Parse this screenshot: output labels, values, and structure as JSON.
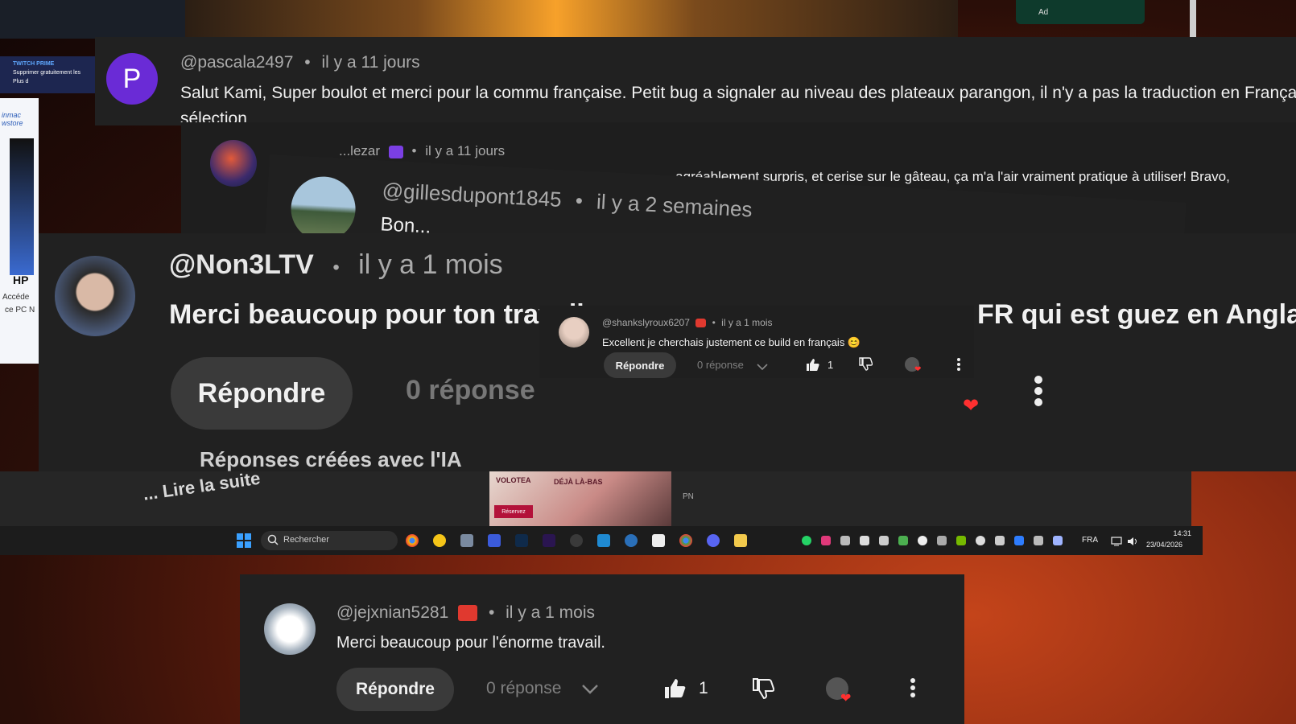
{
  "top_banner": {
    "ad_label": "Ad"
  },
  "twitch_prime": {
    "title": "TWITCH PRIME",
    "line1": "Supprimer gratuitement les",
    "line2": "Plus d"
  },
  "side_promo": {
    "brand": "inmac wstore",
    "model": "HP",
    "line1": "Accéde",
    "line2": "ce PC N"
  },
  "comment_pascala": {
    "avatar_letter": "P",
    "handle": "@pascala2497",
    "sep": "•",
    "time": "il y a 11 jours",
    "text": "Salut Kami, Super boulot et merci pour la commu française. Petit bug a signaler au niveau des plateaux parangon, il n'y a pas la traduction en França",
    "text2": "sélection"
  },
  "comment_hidden": {
    "handle": "...lezar",
    "sep": "•",
    "time": "il y a 11 jours",
    "text": "...agréablement surpris, et cerise sur le gâteau, ça m'a l'air vraiment pratique à utiliser! Bravo,"
  },
  "comment_gilles": {
    "handle": "@gillesdupont1845",
    "sep": "•",
    "time": "il y a 2 semaines",
    "text": "Bon..."
  },
  "comment_non3ltv": {
    "handle": "@Non3LTV",
    "sep": "•",
    "time": "il y a 1 mois",
    "text": "Merci beaucoup pour ton travail",
    "text_tail": "FR qui est guez en Anglais !",
    "reply": "Répondre",
    "replies": "0 réponse",
    "footer": "Réponses créées avec l'IA"
  },
  "comment_shanks": {
    "handle": "@shankslyroux6207",
    "sep": "•",
    "time": "il y a 1 mois",
    "text": "Excellent je cherchais justement ce build en français 😊",
    "reply": "Répondre",
    "replies": "0 réponse",
    "likes": "1"
  },
  "read_more": "... Lire la suite",
  "ad_volotea": {
    "brand": "VOLOTEA",
    "tag": "DÉJÀ LÀ-BAS",
    "cta": "Réservez",
    "badge": "PN"
  },
  "taskbar": {
    "search_placeholder": "Rechercher",
    "lang": "FRA",
    "time": "14:31",
    "date": "23/04/2026"
  },
  "comment_jejx": {
    "handle": "@jejxnian5281",
    "sep": "•",
    "time": "il y a 1 mois",
    "text": "Merci beaucoup pour l'énorme travail.",
    "reply": "Répondre",
    "replies": "0 réponse",
    "likes": "1"
  },
  "colors": {
    "card": "#212121",
    "accent_red": "#e0392f",
    "heart": "#ff3030",
    "avatar_p": "#6a2bd6"
  }
}
